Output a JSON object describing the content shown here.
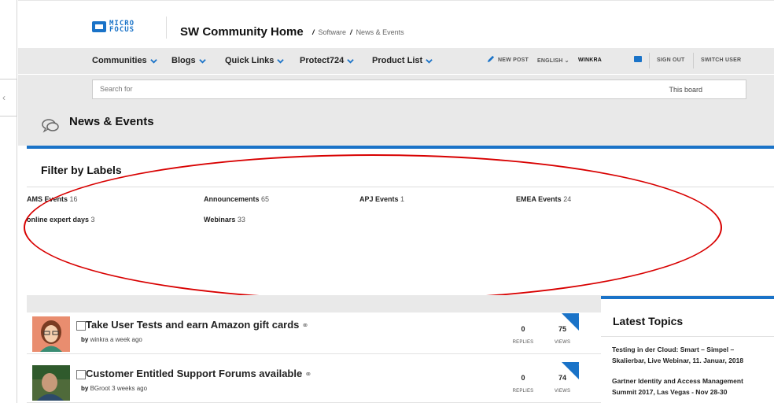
{
  "header": {
    "logo_text_line1": "MICRO",
    "logo_text_line2": "FOCUS",
    "site_title": "SW Community Home",
    "breadcrumb": [
      "Software",
      "News & Events"
    ],
    "breadcrumb_sep": "/"
  },
  "nav": {
    "items": [
      "Communities",
      "Blogs",
      "Quick Links",
      "Protect724",
      "Product List"
    ],
    "new_post": "NEW POST",
    "language": "ENGLISH",
    "username": "WINKRA",
    "sign_out": "SIGN OUT",
    "switch_user": "SWITCH USER"
  },
  "search": {
    "placeholder": "Search for",
    "scope": "This board"
  },
  "board": {
    "title": "News & Events"
  },
  "filter": {
    "title": "Filter by Labels",
    "labels": [
      {
        "name": "AMS Events",
        "count": "16"
      },
      {
        "name": "Announcements",
        "count": "65"
      },
      {
        "name": "APJ Events",
        "count": "1"
      },
      {
        "name": "EMEA Events",
        "count": "24"
      },
      {
        "name": "online expert days",
        "count": "3"
      },
      {
        "name": "Webinars",
        "count": "33"
      }
    ]
  },
  "topics": [
    {
      "title": "Take User Tests and earn Amazon gift cards",
      "by": "by",
      "author": "winkra",
      "age": "a week ago",
      "replies": "0",
      "replies_label": "REPLIES",
      "views": "75",
      "views_label": "VIEWS"
    },
    {
      "title": "Customer Entitled Support Forums available",
      "by": "by",
      "author": "BGroot",
      "age": "3 weeks ago",
      "replies": "0",
      "replies_label": "REPLIES",
      "views": "74",
      "views_label": "VIEWS"
    }
  ],
  "sidebar": {
    "title": "Latest Topics",
    "links": [
      "Testing in der Cloud: Smart – Simpel – Skalierbar, Live Webinar, 11. Januar, 2018",
      "Gartner Identity and Access Management Summit 2017, Las Vegas - Nov 28-30"
    ]
  },
  "colors": {
    "accent": "#1a73c8",
    "annotation": "#d80000",
    "bar_gray": "#e9e9e9"
  }
}
